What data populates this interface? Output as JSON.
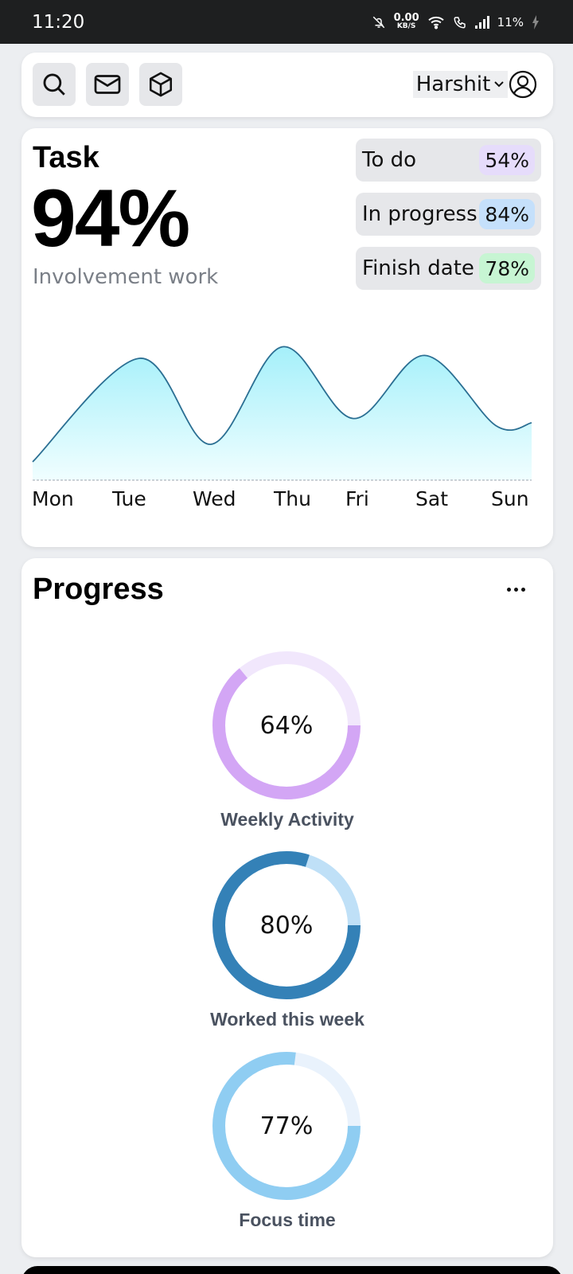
{
  "status_bar": {
    "time": "11:20",
    "net_speed_value": "0.00",
    "net_speed_unit": "KB/S",
    "battery": "11%"
  },
  "header": {
    "icons": [
      "search-icon",
      "mail-icon",
      "box-icon"
    ],
    "user_name": "Harshit"
  },
  "task": {
    "title": "Task",
    "percent": "94%",
    "subtitle": "Involvement work",
    "stats": [
      {
        "label": "To do",
        "value": "54%",
        "badge_color": "#e6dcfb"
      },
      {
        "label": "In progress",
        "value": "84%",
        "badge_color": "#c5e0fb"
      },
      {
        "label": "Finish date",
        "value": "78%",
        "badge_color": "#c7f5d3"
      }
    ]
  },
  "chart_data": {
    "type": "area",
    "categories": [
      "Mon",
      "Tue",
      "Wed",
      "Thu",
      "Fri",
      "Sat",
      "Sun"
    ],
    "values": [
      0,
      85,
      25,
      93,
      43,
      87,
      38
    ],
    "ylim": [
      0,
      100
    ],
    "title": "",
    "xlabel": "",
    "ylabel": "",
    "grid": false,
    "line_color": "#2b6f93",
    "fill_color_top": "#a5f0fa",
    "fill_color_bottom": "#f0feff"
  },
  "progress": {
    "title": "Progress",
    "rings": [
      {
        "value": 64,
        "label_value": "64%",
        "label": "Weekly Activity",
        "color": "#d3a6f5",
        "track": "#f1e7fc"
      },
      {
        "value": 80,
        "label_value": "80%",
        "label": "Worked this week",
        "color": "#3481b7",
        "track": "#bfe0f7"
      },
      {
        "value": 77,
        "label_value": "77%",
        "label": "Focus time",
        "color": "#8fcdf2",
        "track": "#e9f2fc"
      }
    ]
  }
}
